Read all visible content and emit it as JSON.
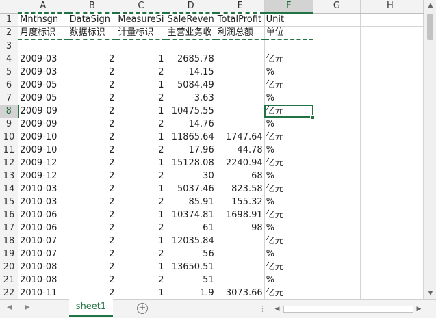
{
  "columns": [
    "A",
    "B",
    "C",
    "D",
    "E",
    "F",
    "G",
    "H"
  ],
  "rows": [
    {
      "n": "1",
      "cells": [
        "Mnthsgn",
        "DataSign",
        "MeasureSi",
        "SaleReven",
        "TotalProfit",
        "Unit",
        "",
        ""
      ]
    },
    {
      "n": "2",
      "cells": [
        "月度标识",
        "数据标识",
        "计量标识",
        "主营业务收",
        "利润总额",
        "单位",
        "",
        ""
      ]
    },
    {
      "n": "3",
      "cells": [
        "",
        "",
        "",
        "",
        "",
        "",
        "",
        ""
      ]
    },
    {
      "n": "4",
      "cells": [
        "2009-03",
        "2",
        "1",
        "2685.78",
        "",
        "亿元",
        "",
        ""
      ]
    },
    {
      "n": "5",
      "cells": [
        "2009-03",
        "2",
        "2",
        "-14.15",
        "",
        "%",
        "",
        ""
      ]
    },
    {
      "n": "6",
      "cells": [
        "2009-05",
        "2",
        "1",
        "5084.49",
        "",
        "亿元",
        "",
        ""
      ]
    },
    {
      "n": "7",
      "cells": [
        "2009-05",
        "2",
        "2",
        "-3.63",
        "",
        "%",
        "",
        ""
      ]
    },
    {
      "n": "8",
      "cells": [
        "2009-09",
        "2",
        "1",
        "10475.55",
        "",
        "亿元",
        "",
        ""
      ]
    },
    {
      "n": "9",
      "cells": [
        "2009-09",
        "2",
        "2",
        "14.76",
        "",
        "%",
        "",
        ""
      ]
    },
    {
      "n": "10",
      "cells": [
        "2009-10",
        "2",
        "1",
        "11865.64",
        "1747.64",
        "亿元",
        "",
        ""
      ]
    },
    {
      "n": "11",
      "cells": [
        "2009-10",
        "2",
        "2",
        "17.96",
        "44.78",
        "%",
        "",
        ""
      ]
    },
    {
      "n": "12",
      "cells": [
        "2009-12",
        "2",
        "1",
        "15128.08",
        "2240.94",
        "亿元",
        "",
        ""
      ]
    },
    {
      "n": "13",
      "cells": [
        "2009-12",
        "2",
        "2",
        "30",
        "68",
        "%",
        "",
        ""
      ]
    },
    {
      "n": "14",
      "cells": [
        "2010-03",
        "2",
        "1",
        "5037.46",
        "823.58",
        "亿元",
        "",
        ""
      ]
    },
    {
      "n": "15",
      "cells": [
        "2010-03",
        "2",
        "2",
        "85.91",
        "155.32",
        "%",
        "",
        ""
      ]
    },
    {
      "n": "16",
      "cells": [
        "2010-06",
        "2",
        "1",
        "10374.81",
        "1698.91",
        "亿元",
        "",
        ""
      ]
    },
    {
      "n": "17",
      "cells": [
        "2010-06",
        "2",
        "2",
        "61",
        "98",
        "%",
        "",
        ""
      ]
    },
    {
      "n": "18",
      "cells": [
        "2010-07",
        "2",
        "1",
        "12035.84",
        "",
        "亿元",
        "",
        ""
      ]
    },
    {
      "n": "19",
      "cells": [
        "2010-07",
        "2",
        "2",
        "56",
        "",
        "%",
        "",
        ""
      ]
    },
    {
      "n": "20",
      "cells": [
        "2010-08",
        "2",
        "1",
        "13650.51",
        "",
        "亿元",
        "",
        ""
      ]
    },
    {
      "n": "21",
      "cells": [
        "2010-08",
        "2",
        "2",
        "51",
        "",
        "%",
        "",
        ""
      ]
    },
    {
      "n": "22",
      "cells": [
        "2010-11",
        "2",
        "1",
        "1.9",
        "3073.66",
        "亿元",
        "",
        ""
      ]
    }
  ],
  "selection": {
    "active_cell": "F8",
    "active_row": "8",
    "active_col": "F"
  },
  "sheet_tab": {
    "name": "sheet1"
  },
  "colors": {
    "accent": "#217346"
  },
  "icons": {
    "prev": "triangle-left-icon",
    "next": "triangle-right-icon",
    "add": "plus-circle-icon"
  }
}
